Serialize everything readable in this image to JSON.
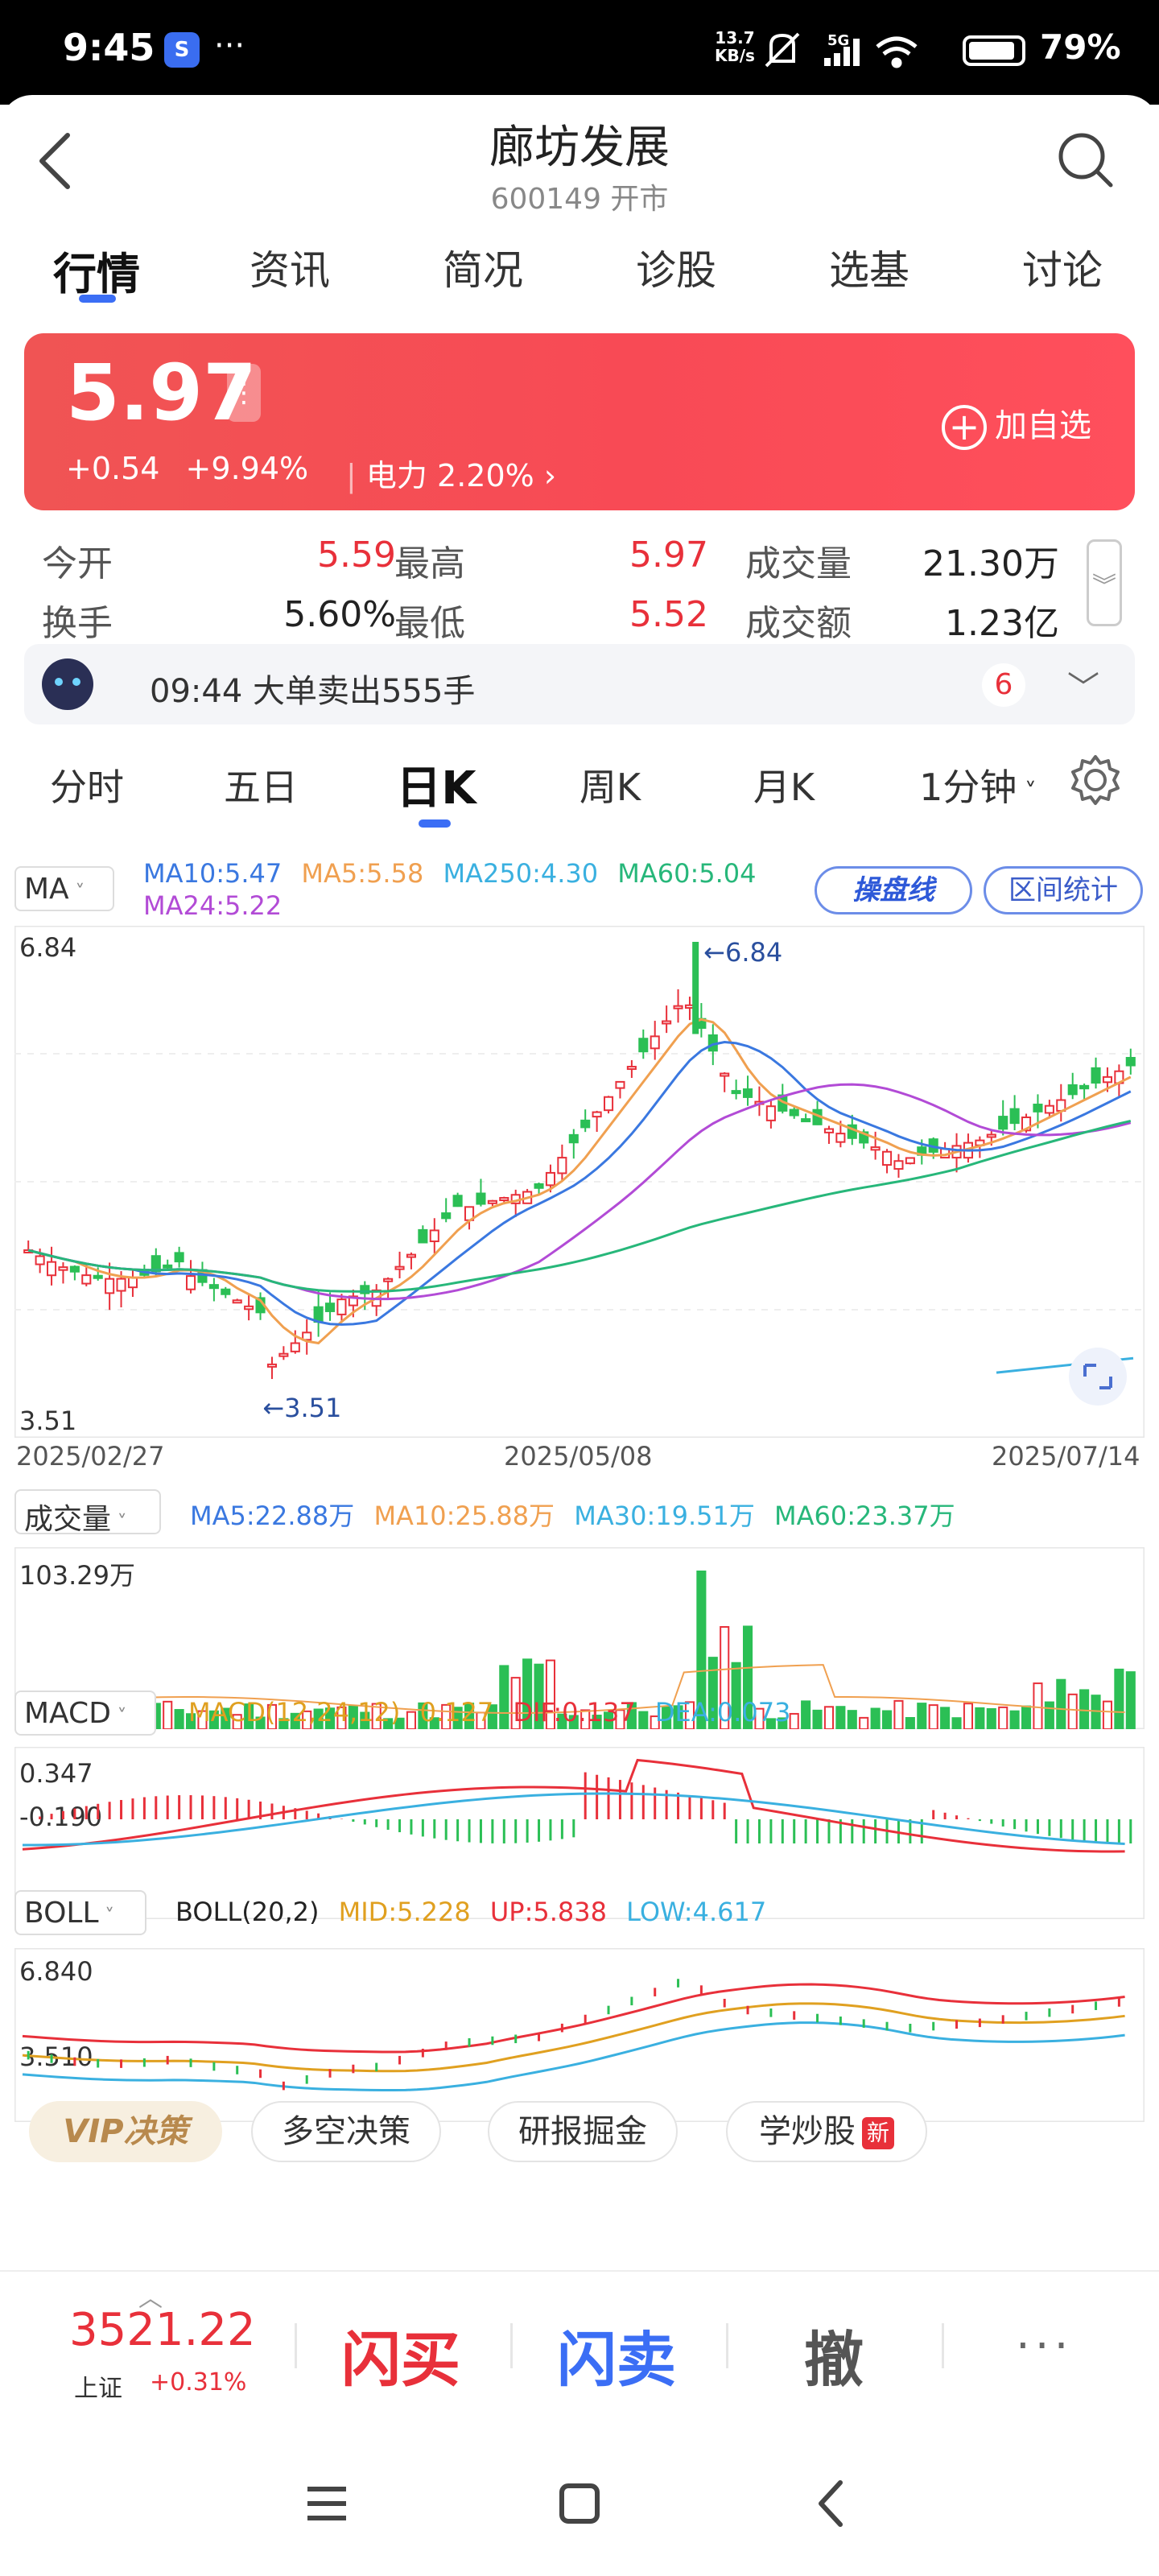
{
  "status_bar": {
    "time": "9:45",
    "app_icon": "S",
    "dots": "···",
    "net_speed_value": "13.7",
    "net_speed_unit": "KB/s",
    "network": "5G",
    "battery": "79%"
  },
  "header": {
    "title": "廊坊发展",
    "subtitle": "600149 开市"
  },
  "tabs": [
    {
      "label": "行情",
      "active": true
    },
    {
      "label": "资讯"
    },
    {
      "label": "简况"
    },
    {
      "label": "诊股"
    },
    {
      "label": "选基"
    },
    {
      "label": "讨论"
    }
  ],
  "quote": {
    "price": "5.97",
    "change": "+0.54",
    "change_pct": "+9.94%",
    "sector_name": "电力",
    "sector_pct": "2.20%",
    "add_watch": "加自选"
  },
  "stats": {
    "open_label": "今开",
    "open": "5.59",
    "high_label": "最高",
    "high": "5.97",
    "volume_label": "成交量",
    "volume": "21.30万",
    "turnover_label": "换手",
    "turnover": "5.60%",
    "low_label": "最低",
    "low": "5.52",
    "amount_label": "成交额",
    "amount": "1.23亿"
  },
  "notice": {
    "text": "09:44 大单卖出555手",
    "count": "6"
  },
  "periods": [
    {
      "label": "分时"
    },
    {
      "label": "五日"
    },
    {
      "label": "日K",
      "active": true
    },
    {
      "label": "周K"
    },
    {
      "label": "月K"
    },
    {
      "label": "1分钟"
    }
  ],
  "chart": {
    "ma_selector": "MA",
    "ma_legend": {
      "ma10": "MA10:5.47",
      "ma5": "MA5:5.58",
      "ma250": "MA250:4.30",
      "ma60": "MA60:5.04",
      "ma24": "MA24:5.22"
    },
    "pill_brand": "操盘线",
    "pill_range": "区间统计",
    "y_max": "6.84",
    "y_min": "3.51",
    "high_marker": "←6.84",
    "low_marker": "←3.51",
    "dates": [
      "2025/02/27",
      "2025/05/08",
      "2025/07/14"
    ],
    "vol_selector": "成交量",
    "vol_legend": {
      "ma5": "MA5:22.88万",
      "ma10": "MA10:25.88万",
      "ma30": "MA30:19.51万",
      "ma60": "MA60:23.37万"
    },
    "vol_max": "103.29万",
    "macd_selector": "MACD",
    "macd_legend": {
      "params": "MACD(12,24,12)",
      "macd": "0.127",
      "dif": "DIF:0.137",
      "dea": "DEA:0.073"
    },
    "macd_max": "0.347",
    "macd_min": "-0.190",
    "boll_selector": "BOLL",
    "boll_legend": {
      "params": "BOLL(20,2)",
      "mid": "MID:5.228",
      "up": "UP:5.838",
      "low": "LOW:4.617"
    },
    "boll_max": "6.840",
    "boll_min": "3.510"
  },
  "chips": [
    {
      "label": "VIP决策"
    },
    {
      "label": "多空决策"
    },
    {
      "label": "研报掘金"
    },
    {
      "label": "学炒股",
      "badge": "新"
    }
  ],
  "tradebar": {
    "index_value": "3521.22",
    "index_name": "上证",
    "index_change": "+0.31%",
    "buy": "闪买",
    "sell": "闪卖",
    "cancel": "撤",
    "more": "···"
  },
  "colors": {
    "up": "#e8303a",
    "down": "#2bbf55",
    "accent": "#3b6ef5",
    "ma5": "#f0a050",
    "ma10": "#3a78e0",
    "ma24": "#b24bd6",
    "ma60": "#27b77a",
    "ma250": "#3ab0e0"
  }
}
